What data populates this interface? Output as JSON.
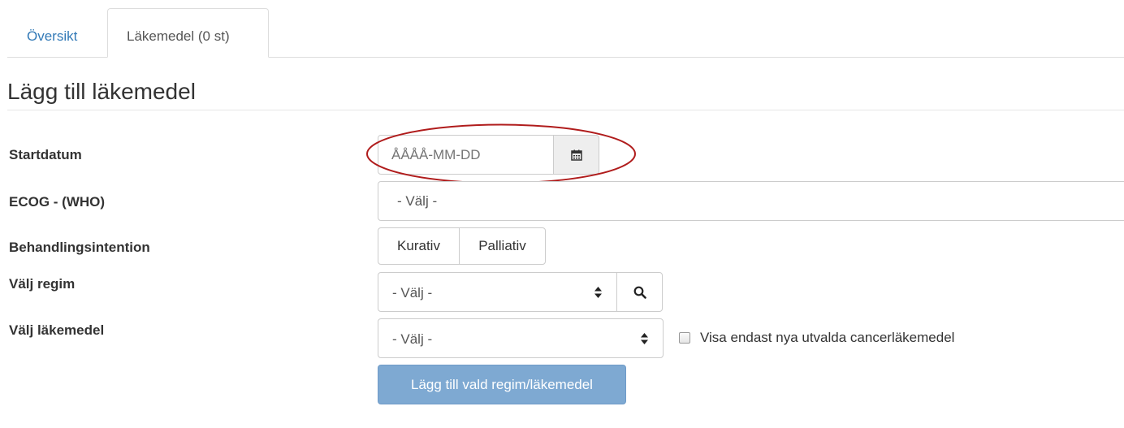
{
  "tabs": {
    "overview": "Översikt",
    "medications": "Läkemedel (0 st)"
  },
  "section": {
    "title": "Lägg till läkemedel"
  },
  "form": {
    "start_date": {
      "label": "Startdatum",
      "placeholder": "ÅÅÅÅ-MM-DD",
      "icon": "calendar-icon"
    },
    "ecog": {
      "label": "ECOG - (WHO)",
      "value": "- Välj -"
    },
    "intention": {
      "label": "Behandlingsintention",
      "options": [
        "Kurativ",
        "Palliativ"
      ]
    },
    "regimen": {
      "label": "Välj regim",
      "value": "- Välj -",
      "icon": "search-icon"
    },
    "drug": {
      "label": "Välj läkemedel",
      "value": "- Välj -"
    },
    "checkbox": {
      "label": "Visa endast nya utvalda cancerläkemedel",
      "checked": false
    },
    "submit": "Lägg till vald regim/läkemedel"
  },
  "colors": {
    "link": "#337ab7",
    "primary_button": "#7ea9d2",
    "highlight_ellipse": "#b01c1c"
  }
}
